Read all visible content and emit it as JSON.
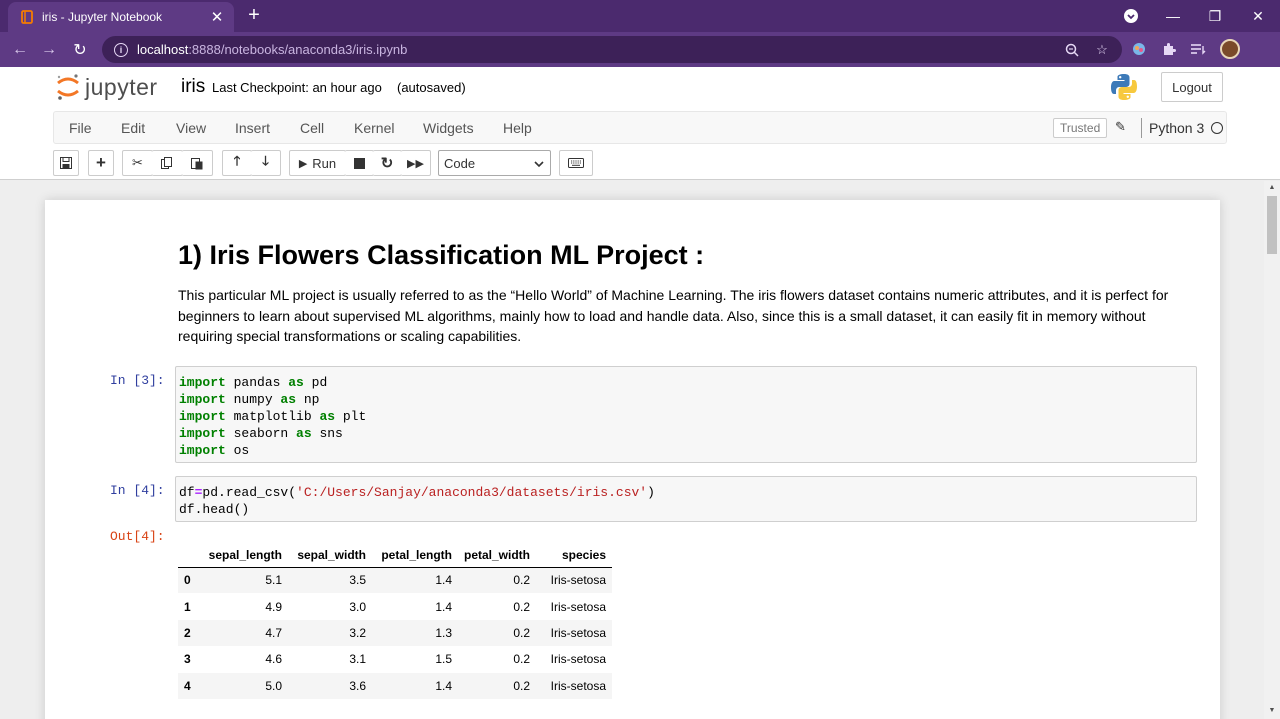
{
  "browser": {
    "tab_title": "iris - Jupyter Notebook",
    "tab_close": "✕",
    "new_tab": "+",
    "url_host": "localhost",
    "url_path": ":8888/notebooks/anaconda3/iris.ipynb",
    "window_controls": [
      "—",
      "❐",
      "✕"
    ]
  },
  "jupyter": {
    "logo_text": "jupyter",
    "notebook_name": "iris",
    "checkpoint": "Last Checkpoint: an hour ago",
    "autosave_status": "(autosaved)",
    "logout_label": "Logout",
    "menu": [
      "File",
      "Edit",
      "View",
      "Insert",
      "Cell",
      "Kernel",
      "Widgets",
      "Help"
    ],
    "trusted_label": "Trusted",
    "kernel_name": "Python 3",
    "run_label": "Run",
    "cell_type": "Code"
  },
  "notebook": {
    "heading": "1) Iris Flowers Classification ML Project :",
    "paragraph": "This particular ML project is usually referred to as the “Hello World” of Machine Learning. The iris flowers dataset contains numeric attributes, and it is perfect for beginners to learn about supervised ML algorithms, mainly how to load and handle data. Also, since this is a small dataset, it can easily fit in memory without requiring special transformations or scaling capabilities.",
    "cell1_prompt": "In [3]:",
    "cell1_lines": [
      {
        "kw": "import",
        "mod": " pandas ",
        "as": "as",
        "alias": " pd"
      },
      {
        "kw": "import",
        "mod": " numpy ",
        "as": "as",
        "alias": " np"
      },
      {
        "kw": "import",
        "mod": " matplotlib ",
        "as": "as",
        "alias": " plt"
      },
      {
        "kw": "import",
        "mod": " seaborn ",
        "as": "as",
        "alias": " sns"
      },
      {
        "kw": "import",
        "mod": " os",
        "as": "",
        "alias": ""
      }
    ],
    "cell2_prompt": "In [4]:",
    "cell2_line1_a": "df",
    "cell2_line1_op": "=",
    "cell2_line1_b": "pd.read_csv(",
    "cell2_line1_str": "'C:/Users/Sanjay/anaconda3/datasets/iris.csv'",
    "cell2_line1_c": ")",
    "cell2_line2": "df.head()",
    "out_prompt": "Out[4]:",
    "table": {
      "columns": [
        "",
        "sepal_length",
        "sepal_width",
        "petal_length",
        "petal_width",
        "species"
      ],
      "rows": [
        [
          "0",
          "5.1",
          "3.5",
          "1.4",
          "0.2",
          "Iris-setosa"
        ],
        [
          "1",
          "4.9",
          "3.0",
          "1.4",
          "0.2",
          "Iris-setosa"
        ],
        [
          "2",
          "4.7",
          "3.2",
          "1.3",
          "0.2",
          "Iris-setosa"
        ],
        [
          "3",
          "4.6",
          "3.1",
          "1.5",
          "0.2",
          "Iris-setosa"
        ],
        [
          "4",
          "5.0",
          "3.6",
          "1.4",
          "0.2",
          "Iris-setosa"
        ]
      ]
    }
  },
  "colors": {
    "chrome": "#4b2a6e",
    "chrome_light": "#5e3a84",
    "prompt_in": "#303f9f",
    "prompt_out": "#d84315",
    "keyword": "#008000",
    "string": "#ba2121"
  }
}
